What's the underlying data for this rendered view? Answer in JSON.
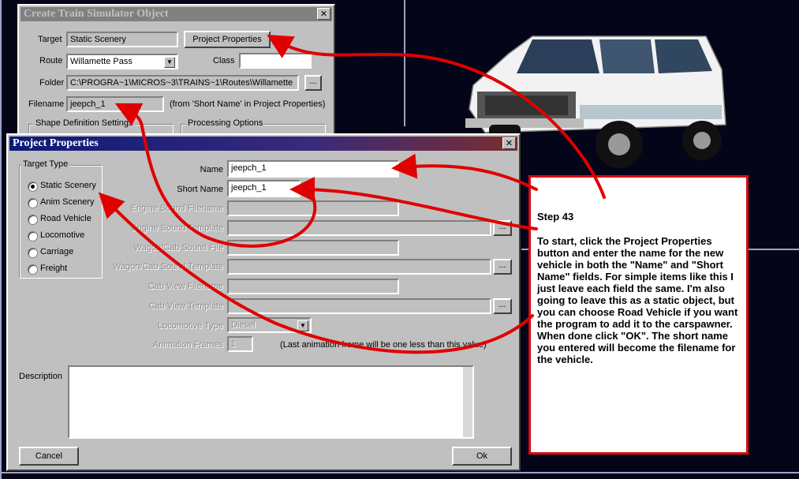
{
  "colors": {
    "arrow": "#e00000",
    "annotation_border": "#d60c12",
    "title_active": "#0a1b78"
  },
  "create_window": {
    "title": "Create Train Simulator Object",
    "target_label": "Target",
    "target_value": "Static Scenery",
    "project_properties_button": "Project Properties",
    "route_label": "Route",
    "route_value": "Willamette Pass",
    "class_label": "Class",
    "class_value": "",
    "folder_label": "Folder",
    "folder_value": "C:\\PROGRA~1\\MICROS~3\\TRAINS~1\\Routes\\Willamette",
    "folder_browse": "...",
    "filename_label": "Filename",
    "filename_value": "jeepch_1",
    "filename_note": "(from 'Short Name' in Project Properties)",
    "shape_group": "Shape Definition Settings",
    "processing_group": "Processing Options"
  },
  "project_properties": {
    "title": "Project Properties",
    "target_type_label": "Target Type",
    "target_types": [
      {
        "label": "Static Scenery",
        "selected": true
      },
      {
        "label": "Anim Scenery",
        "selected": false
      },
      {
        "label": "Road Vehicle",
        "selected": false
      },
      {
        "label": "Locomotive",
        "selected": false
      },
      {
        "label": "Carriage",
        "selected": false
      },
      {
        "label": "Freight",
        "selected": false
      }
    ],
    "name_label": "Name",
    "name_value": "jeepch_1",
    "short_name_label": "Short Name",
    "short_name_value": "jeepch_1",
    "engine_sound_filename_label": "Engine Sound Filename",
    "engine_sound_template_label": "Engine Sound Template",
    "wagon_cab_sound_file_label": "Wagon/Cab Sound File",
    "wagon_cab_sound_template_label": "Wagon/Cab Sound Template",
    "cab_view_filename_label": "Cab View Filename",
    "cab_view_template_label": "Cab View Template",
    "locomotive_type_label": "Locomotive Type",
    "locomotive_type_value": "Diesel",
    "animation_frames_label": "Animation Frames",
    "animation_frames_value": "1",
    "animation_note": "(Last animation frame will be one less than this value)",
    "browse": "...",
    "description_label": "Description",
    "description_value": "",
    "cancel_button": "Cancel",
    "ok_button": "Ok"
  },
  "annotation": {
    "step": "Step 43",
    "text": "To start, click the Project Properties button and enter the name for the new vehicle in both the \"Name\" and \"Short Name\" fields. For simple items like this I just leave each field the same. I'm also going to leave this as a static object, but you can choose Road Vehicle if you want the program to add it to the carspawner. When done click \"OK\". The short name you entered will become the filename for the vehicle."
  },
  "vehicle_image": {
    "icon": "jeep-icon",
    "body_color": "#f2f2f2"
  }
}
